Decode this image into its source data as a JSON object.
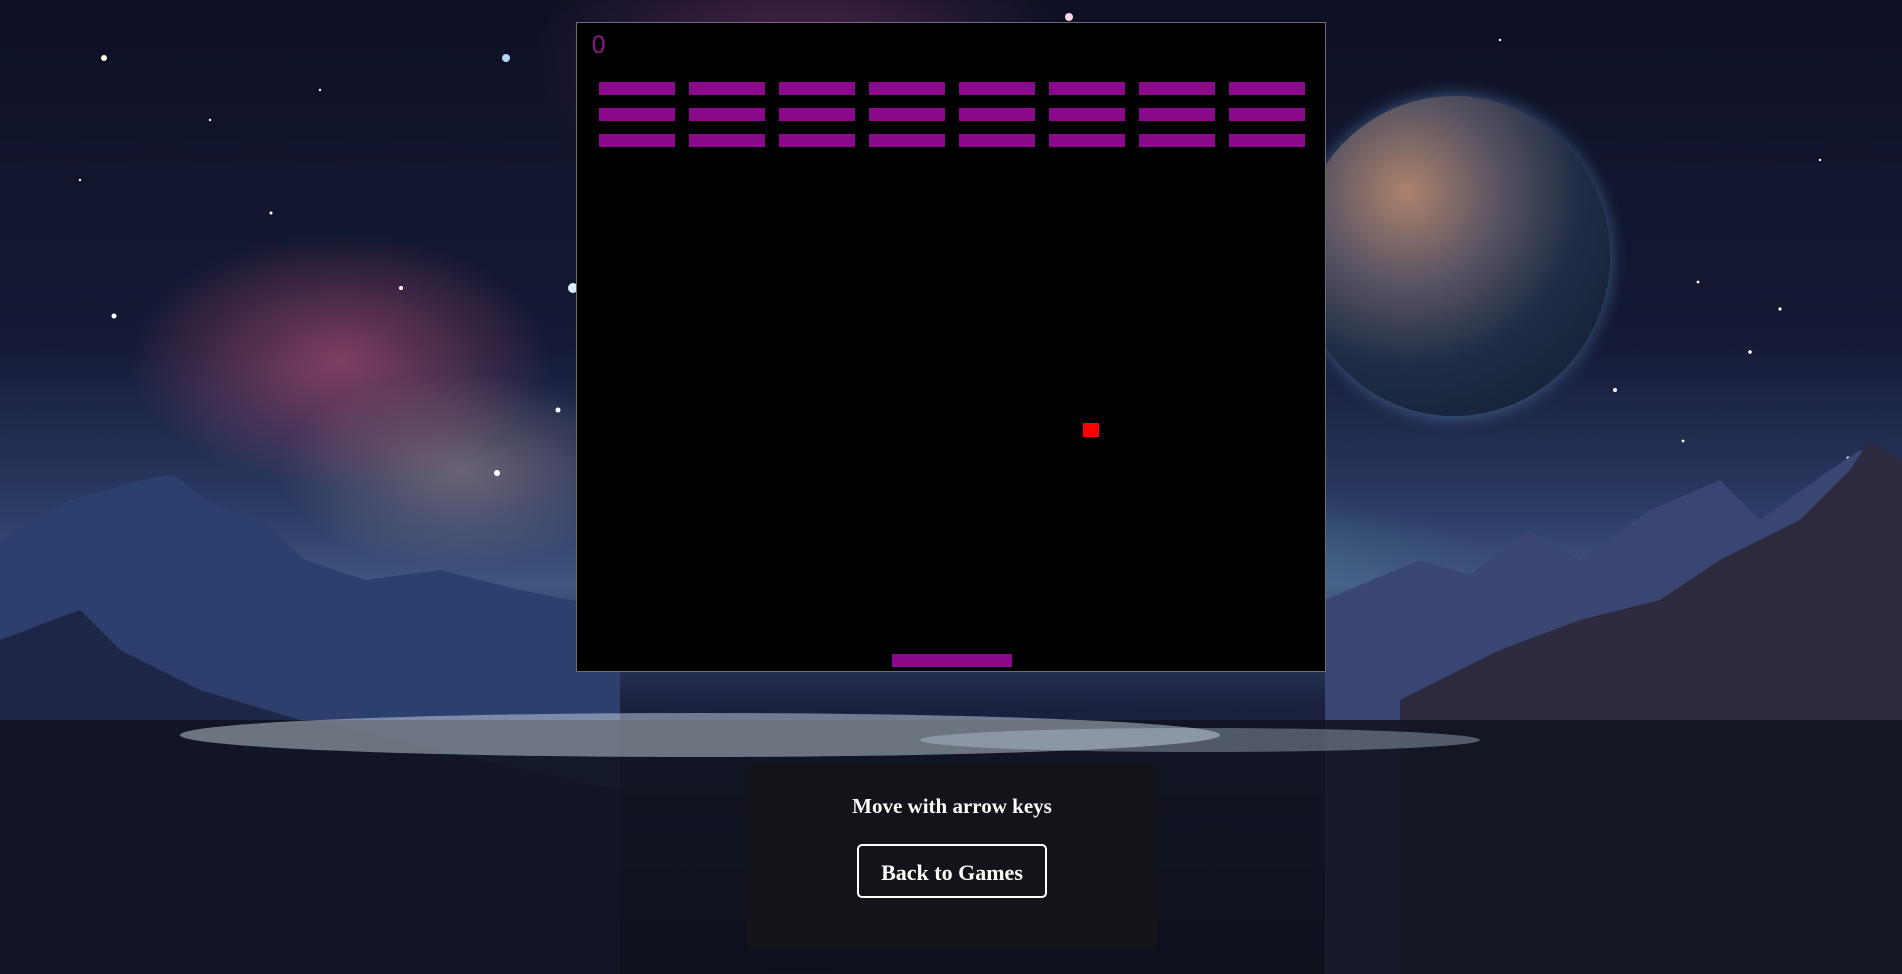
{
  "game": {
    "score": "0",
    "brick_rows": [
      [
        1,
        1,
        1,
        1,
        1,
        1,
        1,
        1
      ],
      [
        1,
        1,
        1,
        1,
        1,
        1,
        1,
        1
      ],
      [
        1,
        1,
        1,
        1,
        1,
        1,
        1,
        1
      ]
    ],
    "colors": {
      "brick": "#8b0a8b",
      "paddle": "#8b0a8b",
      "ball": "#ff0000",
      "score": "#7d1a7d",
      "canvas_background": "#000000"
    }
  },
  "panel": {
    "instructions": "Move with arrow keys",
    "back_button_label": "Back to Games"
  }
}
